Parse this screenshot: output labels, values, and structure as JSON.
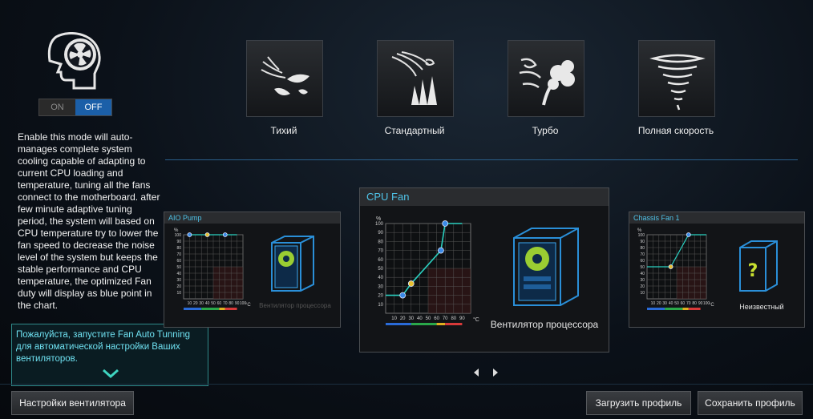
{
  "auto_mode": {
    "toggle_on": "ON",
    "toggle_off": "OFF",
    "description": "Enable this mode will auto-manages complete system cooling capable of adapting to current CPU loading and temperature, tuning all the fans connect to the motherboard. after few minute adaptive tuning period, the system will based on CPU temperature try to lower the fan speed to decrease the noise level of the system but keeps the stable performance and CPU temperature, the optimized Fan duty will display as blue point in the chart.",
    "icon": "head-fan-icon"
  },
  "tip": {
    "text": "Пожалуйста, запустите Fan Auto Tunning для автоматической настройки Ваших вентиляторов."
  },
  "modes": [
    {
      "label": "Тихий",
      "icon": "leaves-icon"
    },
    {
      "label": "Стандартный",
      "icon": "wind-grass-icon"
    },
    {
      "label": "Турбо",
      "icon": "gust-icon"
    },
    {
      "label": "Полная скорость",
      "icon": "tornado-icon"
    }
  ],
  "fans": {
    "left": {
      "title": "AIO Pump",
      "name": "Вентилятор процессора"
    },
    "center": {
      "title": "CPU Fan",
      "name": "Вентилятор процессора"
    },
    "right": {
      "title": "Chassis Fan 1",
      "name": "Неизвестный"
    }
  },
  "chart_data": [
    {
      "type": "line",
      "title": "AIO Pump",
      "ylabel": "%",
      "xlabel": "°C",
      "x_ticks": [
        10,
        20,
        30,
        40,
        50,
        60,
        70,
        80,
        90,
        100
      ],
      "y_ticks": [
        10,
        20,
        30,
        40,
        50,
        60,
        70,
        80,
        90,
        100
      ],
      "series": [
        {
          "x": [
            10,
            40,
            70,
            90
          ],
          "y": [
            100,
            100,
            100,
            100
          ]
        }
      ],
      "xlim": [
        0,
        100
      ],
      "ylim": [
        0,
        100
      ]
    },
    {
      "type": "line",
      "title": "CPU Fan",
      "ylabel": "%",
      "xlabel": "°C",
      "x_ticks": [
        10,
        20,
        30,
        40,
        50,
        60,
        70,
        80,
        90
      ],
      "y_ticks": [
        10,
        20,
        30,
        40,
        50,
        60,
        70,
        80,
        90,
        100
      ],
      "series": [
        {
          "x": [
            0,
            20,
            30,
            65,
            70,
            90
          ],
          "y": [
            20,
            20,
            33,
            70,
            100,
            100
          ]
        }
      ],
      "xlim": [
        0,
        100
      ],
      "ylim": [
        0,
        100
      ]
    },
    {
      "type": "line",
      "title": "Chassis Fan 1",
      "ylabel": "%",
      "xlabel": "°C",
      "x_ticks": [
        10,
        20,
        30,
        40,
        50,
        60,
        70,
        80,
        90,
        100
      ],
      "y_ticks": [
        10,
        20,
        30,
        40,
        50,
        60,
        70,
        80,
        90,
        100
      ],
      "series": [
        {
          "x": [
            0,
            40,
            70,
            100
          ],
          "y": [
            50,
            50,
            100,
            100
          ]
        }
      ],
      "xlim": [
        0,
        100
      ],
      "ylim": [
        0,
        100
      ]
    }
  ],
  "footer": {
    "fan_settings": "Настройки вентилятора",
    "load_profile": "Загрузить профиль",
    "save_profile": "Сохранить профиль"
  }
}
